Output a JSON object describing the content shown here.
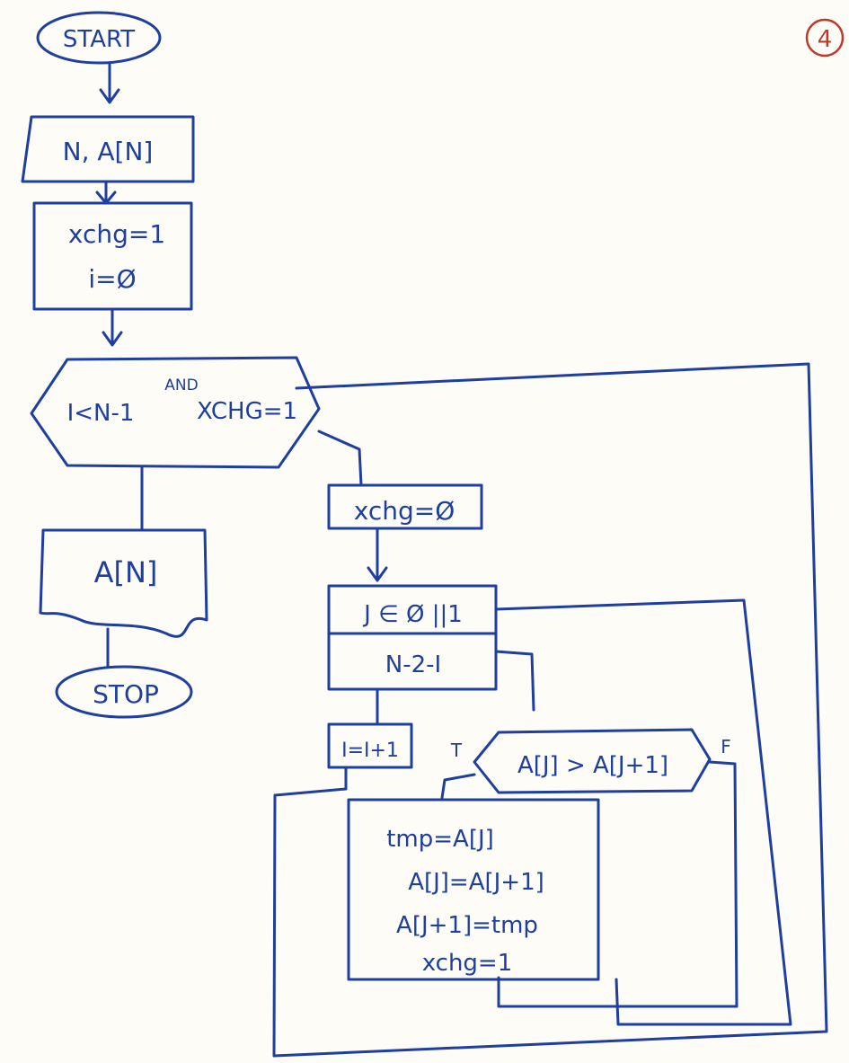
{
  "page_number": "4",
  "flowchart": {
    "start": "START",
    "input": "N, A[N]",
    "init": [
      "xchg=1",
      "i=Ø"
    ],
    "loop_condition": {
      "left": "I<N-1",
      "connector": "AND",
      "right": "XCHG=1"
    },
    "reset": "xchg=Ø",
    "for_loop": {
      "range": "J ∈ Ø ||1",
      "limit": "N-2-I"
    },
    "increment": "I=I+1",
    "compare": {
      "condition": "A[J] > A[J+1]",
      "true_label": "T",
      "false_label": "F"
    },
    "swap": [
      "tmp=A[J]",
      "A[J]=A[J+1]",
      "A[J+1]=tmp",
      "xchg=1"
    ],
    "output": "A[N]",
    "stop": "STOP"
  }
}
